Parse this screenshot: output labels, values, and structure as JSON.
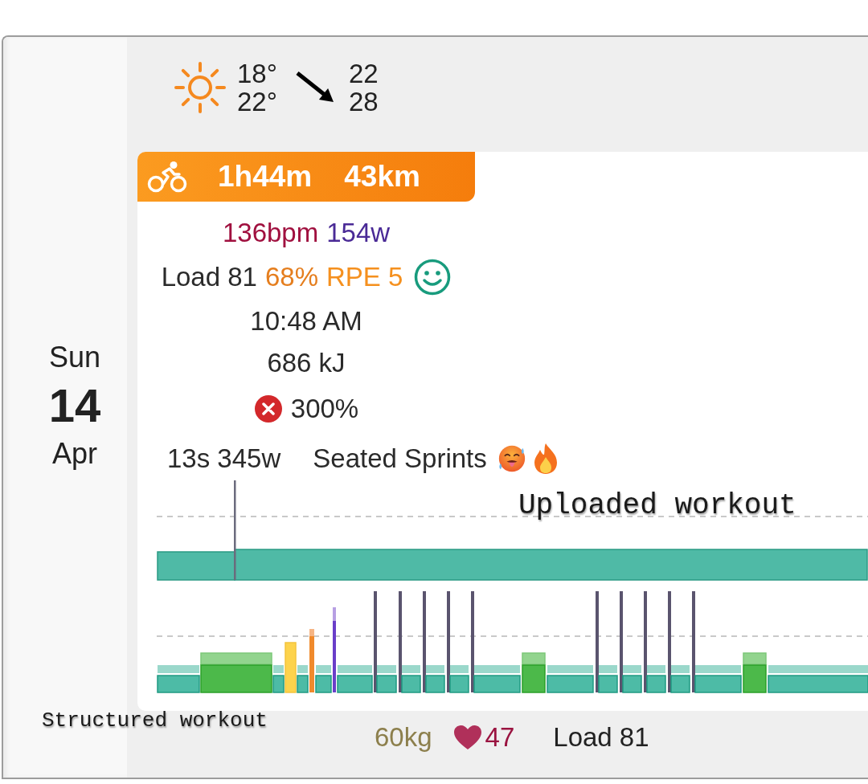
{
  "day": {
    "weekday": "Sun",
    "day": "14",
    "month": "Apr"
  },
  "weather": {
    "temperatures": [
      "18°",
      "22°"
    ],
    "wind": [
      "22",
      "28"
    ]
  },
  "activity": {
    "duration": "1h44m",
    "distance": "43km",
    "heart_rate": "136bpm",
    "power": "154w",
    "load": "Load 81",
    "intensity": "68%",
    "rpe": "RPE 5",
    "start_time": "10:48 AM",
    "work": "686 kJ",
    "compliance_met": false,
    "compliance": "300%",
    "peak": "13s 345w",
    "title": "Seated Sprints"
  },
  "annotations": {
    "chart": "Uploaded workout",
    "footer": "Structured workout"
  },
  "footer": {
    "weight": "60kg",
    "resting_hr": "47",
    "load": "Load 81"
  }
}
